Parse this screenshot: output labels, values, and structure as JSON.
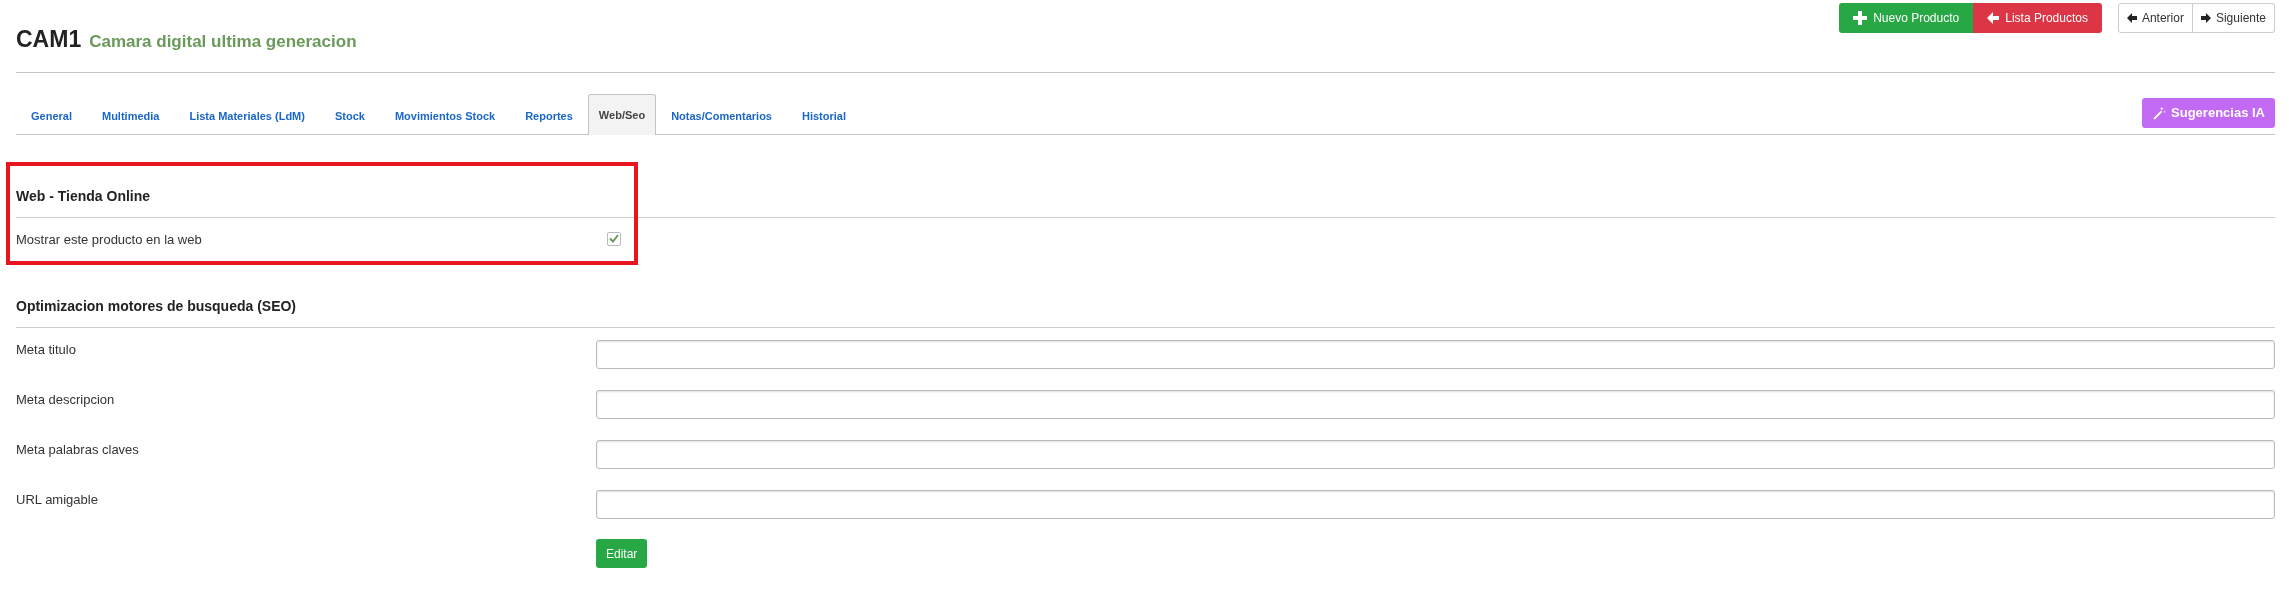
{
  "header": {
    "code": "CAM1",
    "name": "Camara digital ultima generacion"
  },
  "actions": [
    {
      "kind": "new",
      "label": "Nuevo Producto"
    },
    {
      "kind": "list",
      "label": "Lista Productos"
    }
  ],
  "pager": [
    {
      "kind": "prev",
      "label": "Anterior"
    },
    {
      "kind": "next",
      "label": "Siguiente"
    }
  ],
  "tabs": [
    {
      "label": "General",
      "selected": false
    },
    {
      "label": "Multimedia",
      "selected": false
    },
    {
      "label": "Lista Materiales (LdM)",
      "selected": false
    },
    {
      "label": "Stock",
      "selected": false
    },
    {
      "label": "Movimientos Stock",
      "selected": false
    },
    {
      "label": "Reportes",
      "selected": false
    },
    {
      "label": "Web/Seo",
      "selected": true
    },
    {
      "label": "Notas/Comentarios",
      "selected": false
    },
    {
      "label": "Historial",
      "selected": false
    }
  ],
  "ai_button": {
    "label": "Sugerencias IA"
  },
  "sections": [
    {
      "title": "Web - Tienda Online",
      "highlighted": true,
      "fields": [
        {
          "kind": "checkbox",
          "label": "Mostrar este producto en la web",
          "checked": true
        }
      ]
    },
    {
      "title": "Optimizacion motores de busqueda (SEO)",
      "highlighted": false,
      "fields": [
        {
          "kind": "text",
          "label": "Meta titulo"
        },
        {
          "kind": "text",
          "label": "Meta descripcion"
        },
        {
          "kind": "text",
          "label": "Meta palabras claves"
        },
        {
          "kind": "text",
          "label": "URL amigable"
        }
      ]
    }
  ],
  "submit": {
    "label": "Editar"
  }
}
